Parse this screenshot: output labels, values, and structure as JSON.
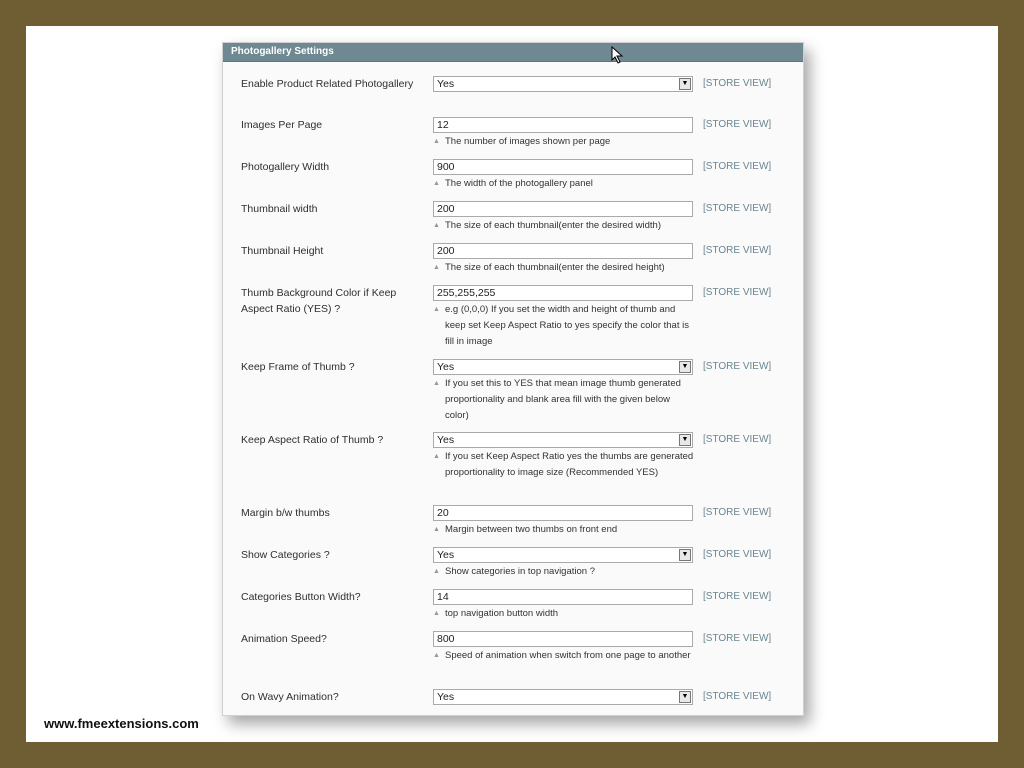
{
  "panel": {
    "title": "Photogallery Settings"
  },
  "footer": {
    "site": "www.fmeextensions.com"
  },
  "rows": [
    {
      "label": "Enable Product Related Photogallery",
      "type": "select",
      "value": "Yes",
      "scope": "[STORE VIEW]",
      "note": ""
    },
    {
      "label": "Images Per Page",
      "type": "text",
      "value": "12",
      "scope": "[STORE VIEW]",
      "note": "The number of images shown per page"
    },
    {
      "label": "Photogallery Width",
      "type": "text",
      "value": "900",
      "scope": "[STORE VIEW]",
      "note": "The width of the photogallery panel"
    },
    {
      "label": "Thumbnail width",
      "type": "text",
      "value": "200",
      "scope": "[STORE VIEW]",
      "note": "The size of each thumbnail(enter the desired width)"
    },
    {
      "label": "Thumbnail Height",
      "type": "text",
      "value": "200",
      "scope": "[STORE VIEW]",
      "note": "The size of each thumbnail(enter the desired height)"
    },
    {
      "label": "Thumb Background Color if Keep Aspect Ratio (YES) ?",
      "type": "text",
      "value": "255,255,255",
      "scope": "[STORE VIEW]",
      "note": "e.g (0,0,0) If you set the width and height of thumb and keep set Keep Aspect Ratio to yes specify the color that is fill in image"
    },
    {
      "label": "Keep Frame of Thumb ?",
      "type": "select",
      "value": "Yes",
      "scope": "[STORE VIEW]",
      "note": "If you set this to YES that mean image thumb generated proportionality and blank area fill with the given below color)"
    },
    {
      "label": "Keep Aspect Ratio of Thumb ?",
      "type": "select",
      "value": "Yes",
      "scope": "[STORE VIEW]",
      "note": "If you set Keep Aspect Ratio yes the thumbs are generated proportionality to image size (Recommended YES)"
    },
    {
      "label": "Margin b/w thumbs",
      "type": "text",
      "value": "20",
      "scope": "[STORE VIEW]",
      "note": "Margin between two thumbs on front end"
    },
    {
      "label": "Show Categories ?",
      "type": "select",
      "value": "Yes",
      "scope": "[STORE VIEW]",
      "note": "Show categories in top navigation ?"
    },
    {
      "label": "Categories Button Width?",
      "type": "text",
      "value": "14",
      "scope": "[STORE VIEW]",
      "note": "top navigation button width"
    },
    {
      "label": "Animation Speed?",
      "type": "text",
      "value": "800",
      "scope": "[STORE VIEW]",
      "note": "Speed of animation when switch from one page to another"
    },
    {
      "label": "On Wavy Animation?",
      "type": "select",
      "value": "Yes",
      "scope": "[STORE VIEW]",
      "note": ""
    }
  ]
}
